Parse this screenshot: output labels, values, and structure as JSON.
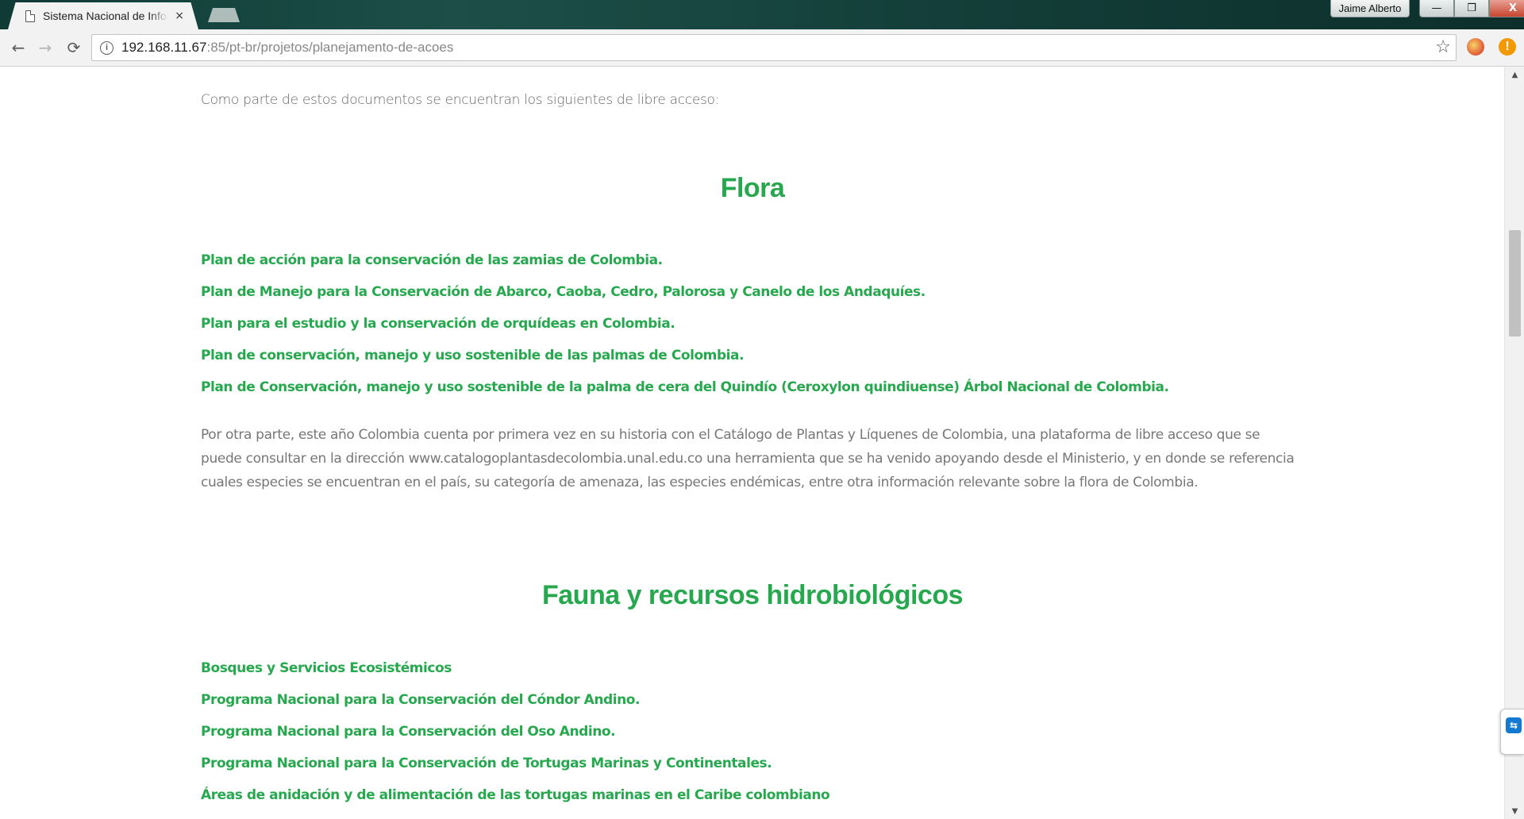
{
  "browser": {
    "tab_title": "Sistema Nacional de Informação",
    "tab_close": "×",
    "profile_name": "Jaime Alberto",
    "window_controls": {
      "minimize": "—",
      "maximize": "❐",
      "close": "X"
    },
    "nav": {
      "back": "←",
      "forward": "→",
      "reload": "⟳"
    },
    "url_host": "192.168.11.67",
    "url_path": ":85/pt-br/projetos/planejamento-de-acoes",
    "info_icon": "i",
    "star": "☆",
    "alert": "!"
  },
  "page": {
    "intro": "Como parte de estos documentos se encuentran los siguientes de libre acceso:",
    "flora": {
      "title": "Flora",
      "links": [
        "Plan de acción para la conservación de las zamias de Colombia.",
        "Plan de Manejo para la Conservación de Abarco, Caoba, Cedro, Palorosa y Canelo de los Andaquíes.",
        "Plan para el estudio y la conservación de orquídeas en Colombia.",
        "Plan de conservación, manejo y uso sostenible de las palmas de Colombia.",
        "Plan de Conservación, manejo y uso sostenible de la palma de cera del Quindío (Ceroxylon quindiuense) Árbol Nacional de Colombia."
      ]
    },
    "paragraph": "Por otra parte, este año Colombia cuenta por primera vez en su historia con el Catálogo de Plantas y Líquenes de Colombia, una plataforma de libre acceso que se puede consultar en la dirección www.catalogoplantasdecolombia.unal.edu.co una herramienta que se ha venido apoyando desde el Ministerio, y en donde se referencia cuales especies se encuentran en el país, su categoría de amenaza, las especies endémicas, entre otra información relevante sobre la flora de Colombia.",
    "fauna": {
      "title": "Fauna y recursos hidrobiológicos",
      "links": [
        "Bosques y Servicios Ecosistémicos",
        "Programa Nacional para la Conservación del Cóndor Andino.",
        "Programa Nacional para la Conservación del Oso Andino.",
        "Programa Nacional para la Conservación de Tortugas Marinas y Continentales.",
        "Áreas de anidación y de alimentación de las tortugas marinas en el Caribe colombiano"
      ]
    }
  },
  "scrollbar": {
    "up": "▲",
    "down": "▼",
    "position_fraction": 0.24
  },
  "colors": {
    "accent_green": "#27a84f",
    "body_text": "#777777"
  },
  "icons": [
    "page-icon",
    "info-icon",
    "star-icon",
    "extension-icon",
    "alert-icon",
    "teamviewer-icon"
  ]
}
